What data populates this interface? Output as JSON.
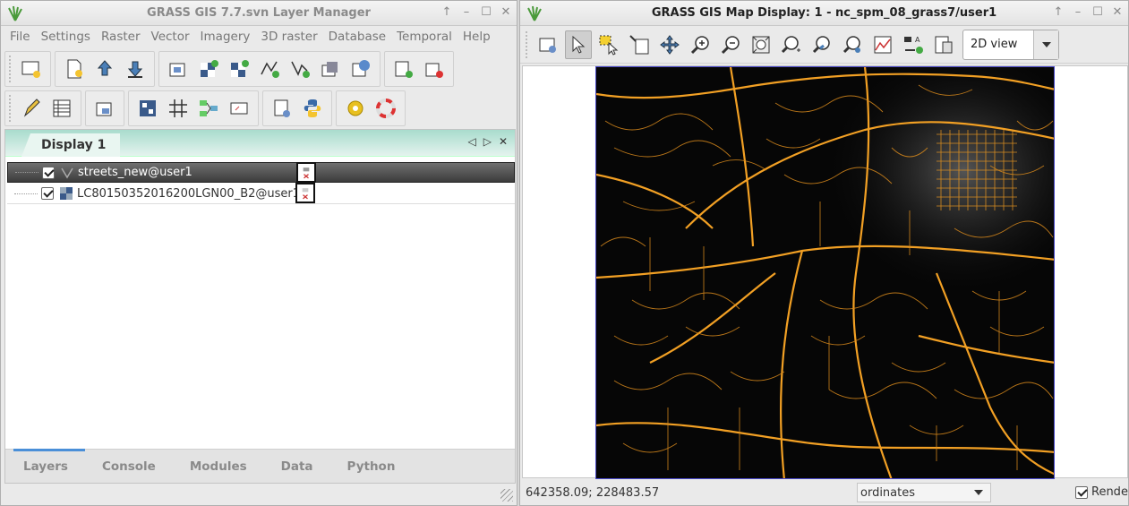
{
  "layer_manager": {
    "title": "GRASS GIS 7.7.svn Layer Manager",
    "menu": [
      "File",
      "Settings",
      "Raster",
      "Vector",
      "Imagery",
      "3D raster",
      "Database",
      "Temporal",
      "Help"
    ],
    "display_tab": "Display 1",
    "layers": [
      {
        "name": "streets_new@user1",
        "checked": true,
        "type": "vector",
        "selected": true
      },
      {
        "name": "LC80150352016200LGN00_B2@user1",
        "checked": true,
        "type": "raster",
        "selected": false
      }
    ],
    "bottom_tabs": [
      "Layers",
      "Console",
      "Modules",
      "Data",
      "Python"
    ],
    "active_bottom_tab": "Layers"
  },
  "map_display": {
    "title": "GRASS GIS Map Display: 1 - nc_spm_08_grass7/user1",
    "view_mode": "2D view",
    "coordinates": "642358.09; 228483.57",
    "coord_mode": "ordinates",
    "render_label": "Rende",
    "render_checked": true
  },
  "colors": {
    "accent_tab": "#a9dccd",
    "streets": "#f5a623",
    "map_border": "#4848c8",
    "active_tab_bar": "#4a8fd8"
  }
}
